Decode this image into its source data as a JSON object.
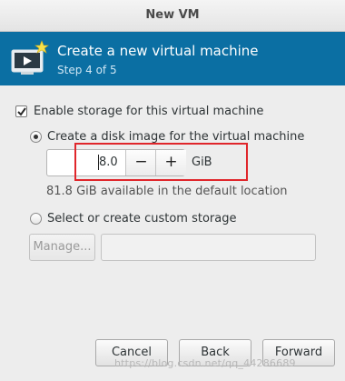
{
  "window": {
    "title": "New VM"
  },
  "banner": {
    "title": "Create a new virtual machine",
    "step": "Step 4 of 5",
    "icon": "virtual-machine-new-icon"
  },
  "storage": {
    "enable_label": "Enable storage for this virtual machine",
    "enable_checked": true,
    "disk_option_label": "Create a disk image for the virtual machine",
    "disk_option_selected": true,
    "size_value": "8.0",
    "size_unit": "GiB",
    "minus_label": "−",
    "plus_label": "+",
    "available_text": "81.8 GiB available in the default location",
    "custom_option_label": "Select or create custom storage",
    "custom_option_selected": false,
    "manage_label": "Manage...",
    "path_value": ""
  },
  "footer": {
    "cancel_label": "Cancel",
    "back_label": "Back",
    "forward_label": "Forward"
  },
  "watermark": "https://blog.csdn.net/qq_44286689",
  "colors": {
    "banner": "#0b6fa3",
    "highlight": "#e0262b"
  }
}
